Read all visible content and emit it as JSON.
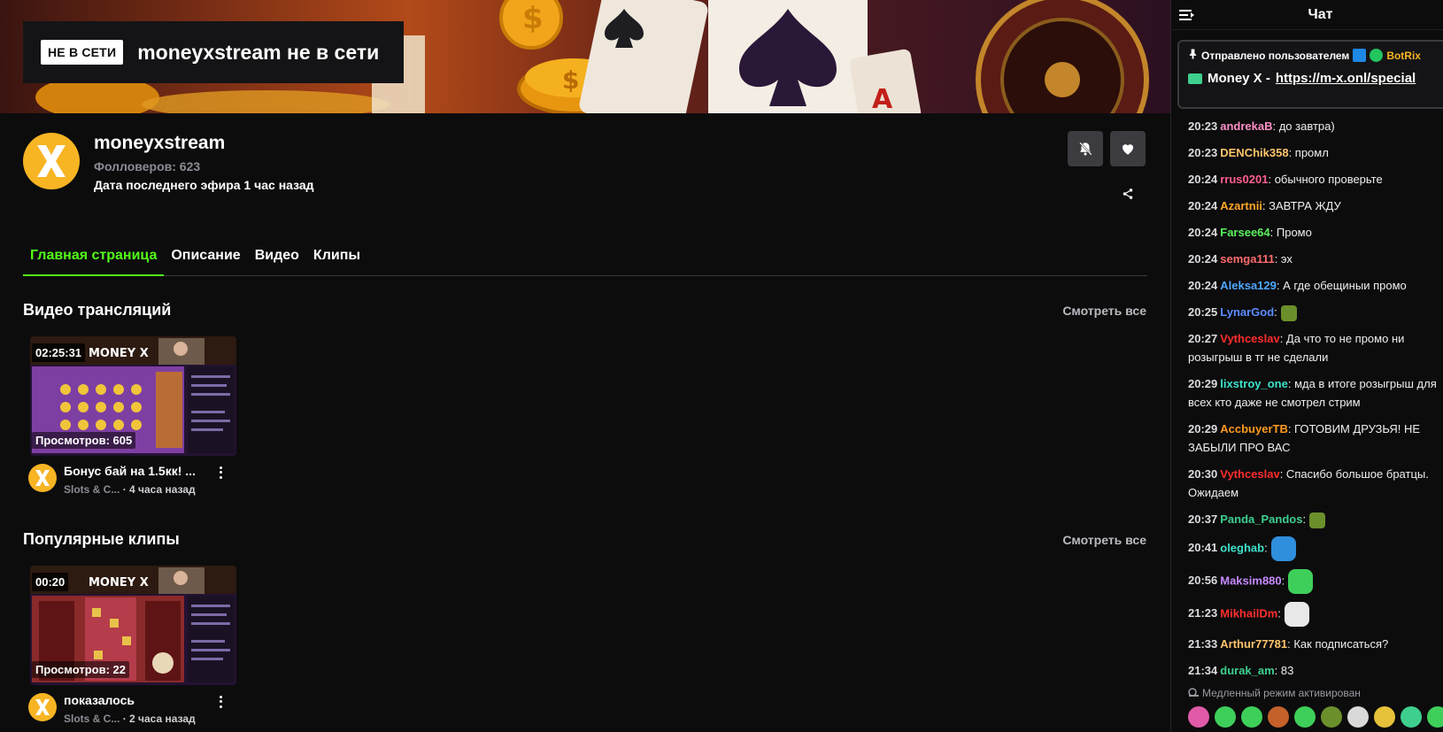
{
  "banner": {
    "offline_badge": "НЕ В СЕТИ",
    "offline_title": "moneyxstream не в сети"
  },
  "channel": {
    "name": "moneyxstream",
    "followers": "Фолловеров: 623",
    "last_stream": "Дата последнего эфира 1 час назад",
    "avatar_letter": "X"
  },
  "tabs": [
    {
      "label": "Главная страница",
      "active": true
    },
    {
      "label": "Описание",
      "active": false
    },
    {
      "label": "Видео",
      "active": false
    },
    {
      "label": "Клипы",
      "active": false
    }
  ],
  "videos_section": {
    "title": "Видео трансляций",
    "see_all": "Смотреть все",
    "item": {
      "duration": "02:25:31",
      "views": "Просмотров: 605",
      "title": "Бонус бай на 1.5кк! ...",
      "category": "Slots & C...",
      "ago": "· 4 часа назад",
      "brand": "MONEY X"
    }
  },
  "clips_section": {
    "title": "Популярные клипы",
    "see_all": "Смотреть все",
    "item": {
      "duration": "00:20",
      "views": "Просмотров: 22",
      "title": "показалось",
      "category": "Slots & C...",
      "ago": "· 2 часа назад",
      "brand": "MONEY X"
    }
  },
  "chat": {
    "title": "Чат",
    "pinned": {
      "sent_by": "Отправлено пользователем",
      "bot_name": "BotRix",
      "text": "Money X - ",
      "link": "https://m-x.onl/special"
    },
    "messages": [
      {
        "time": "20:23",
        "user": "andrekaB",
        "color": "#ff8fc8",
        "text": ": до завтра)"
      },
      {
        "time": "20:23",
        "user": "DENChik358",
        "color": "#ffc46b",
        "text": ": промл"
      },
      {
        "time": "20:24",
        "user": "rrus0201",
        "color": "#ff5f8f",
        "text": ": обычного проверьте"
      },
      {
        "time": "20:24",
        "user": "Azartnii",
        "color": "#ffa726",
        "text": ": ЗАВТРА ЖДУ"
      },
      {
        "time": "20:24",
        "user": "Farsee64",
        "color": "#5cf05c",
        "text": ": Промо"
      },
      {
        "time": "20:24",
        "user": "semga111",
        "color": "#ff6b6b",
        "text": ": эх"
      },
      {
        "time": "20:24",
        "user": "Aleksa129",
        "color": "#4fa8ff",
        "text": ": А где обещиныи промо"
      },
      {
        "time": "20:25",
        "user": "LynarGod",
        "color": "#5b8cff",
        "text": ":"
      },
      {
        "time": "20:27",
        "user": "Vythceslav",
        "color": "#ff2d2d",
        "text": ": Да что то не промо ни розыгрыш в тг не сделали"
      },
      {
        "time": "20:29",
        "user": "lixstroy_one",
        "color": "#3ee0c9",
        "text": ": мда в итоге розыгрыш для всех кто даже не смотрел стрим"
      },
      {
        "time": "20:29",
        "user": "AccbuyerTB",
        "color": "#ff9a1f",
        "text": ": ГОТОВИМ ДРУЗЬЯ! НЕ ЗАБЫЛИ ПРО ВАС"
      },
      {
        "time": "20:30",
        "user": "Vythceslav",
        "color": "#ff2d2d",
        "text": ": Спасибо большое братцы. Ожидаем"
      },
      {
        "time": "20:37",
        "user": "Panda_Pandos",
        "color": "#3ecf8e",
        "text": ":"
      },
      {
        "time": "20:41",
        "user": "oleghab",
        "color": "#3ee0c9",
        "text": ":"
      },
      {
        "time": "20:56",
        "user": "Maksim880",
        "color": "#c78bff",
        "text": ":"
      },
      {
        "time": "21:23",
        "user": "MikhailDm",
        "color": "#ff2d2d",
        "text": ":"
      },
      {
        "time": "21:33",
        "user": "Arthur77781",
        "color": "#ffc46b",
        "text": ": Как подписаться?"
      },
      {
        "time": "21:34",
        "user": "durak_am",
        "color": "#3ecf8e",
        "text": ": 83"
      }
    ],
    "slow_mode": "Медленный режим активирован"
  },
  "colors": {
    "accent": "#53fc18",
    "background": "#0c0c0d",
    "avatar": "#f7b423"
  }
}
